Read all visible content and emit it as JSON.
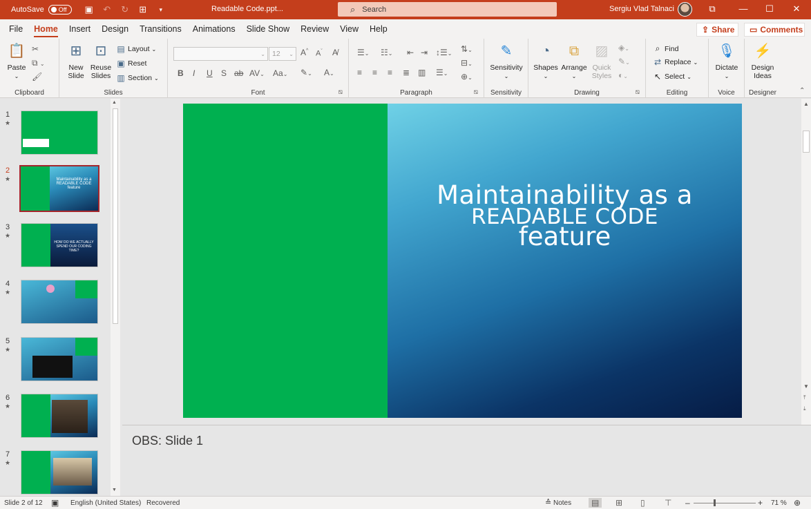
{
  "titlebar": {
    "autosave_label": "AutoSave",
    "autosave_state": "Off",
    "doc_title": "Readable Code.ppt...",
    "search_placeholder": "Search",
    "user_name": "Sergiu Vlad Talnaci",
    "accent_color": "#c43e1c"
  },
  "menu": {
    "tabs": [
      "File",
      "Home",
      "Insert",
      "Design",
      "Transitions",
      "Animations",
      "Slide Show",
      "Review",
      "View",
      "Help"
    ],
    "active_tab": "Home",
    "share_label": "Share",
    "comments_label": "Comments"
  },
  "ribbon": {
    "clipboard": {
      "label": "Clipboard",
      "paste": "Paste"
    },
    "slides": {
      "label": "Slides",
      "new_slide_1": "New",
      "new_slide_2": "Slide",
      "reuse_1": "Reuse",
      "reuse_2": "Slides",
      "layout": "Layout",
      "reset": "Reset",
      "section": "Section"
    },
    "font": {
      "label": "Font",
      "size": "12"
    },
    "paragraph": {
      "label": "Paragraph"
    },
    "sensitivity": {
      "label": "Sensitivity",
      "button": "Sensitivity"
    },
    "drawing": {
      "label": "Drawing",
      "shapes": "Shapes",
      "arrange": "Arrange",
      "quick_1": "Quick",
      "quick_2": "Styles"
    },
    "editing": {
      "label": "Editing",
      "find": "Find",
      "replace": "Replace",
      "select": "Select"
    },
    "voice": {
      "label": "Voice",
      "dictate": "Dictate"
    },
    "designer": {
      "label": "Designer",
      "ideas_1": "Design",
      "ideas_2": "Ideas"
    }
  },
  "thumbnails": [
    {
      "num": "1",
      "text": ""
    },
    {
      "num": "2",
      "text": "Maintainability as a READABLE CODE feature"
    },
    {
      "num": "3",
      "text": "HOW DO WE ACTUALLY SPEND OUR CODING TIME?"
    },
    {
      "num": "4",
      "text": ""
    },
    {
      "num": "5",
      "text": ""
    },
    {
      "num": "6",
      "text": ""
    },
    {
      "num": "7",
      "text": ""
    }
  ],
  "selected_slide": 2,
  "slide": {
    "title_line1": "Maintainability as a",
    "title_line2": "READABLE CODE",
    "title_line3": "feature",
    "green_color": "#00b050"
  },
  "notes": {
    "text": "OBS: Slide 1"
  },
  "status": {
    "slide_count": "Slide 2 of 12",
    "language": "English (United States)",
    "recovered": "Recovered",
    "notes_label": "Notes",
    "zoom": "71 %"
  }
}
